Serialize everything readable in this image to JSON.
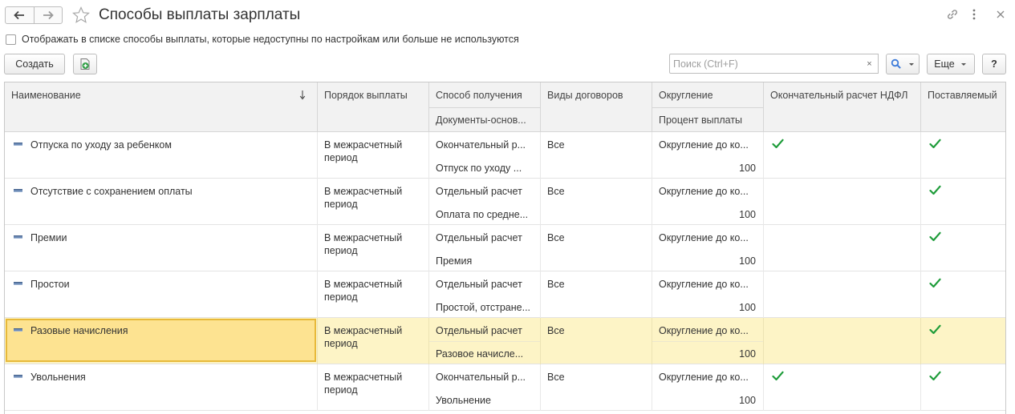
{
  "header": {
    "title": "Способы выплаты зарплаты"
  },
  "options": {
    "show_unavailable_label": "Отображать в списке способы выплаты, которые недоступны по настройкам или больше не используются"
  },
  "toolbar": {
    "create_label": "Создать",
    "search_placeholder": "Поиск (Ctrl+F)",
    "search_clear": "×",
    "more_label": "Еще",
    "help_label": "?"
  },
  "columns": {
    "name": "Наименование",
    "pay_order": "Порядок выплаты",
    "method": "Способ получения",
    "docs_basis": "Документы-основ...",
    "contracts": "Виды договоров",
    "rounding": "Округление",
    "pay_percent": "Процент выплаты",
    "final_ndfl": "Окончательный расчет НДФЛ",
    "supplied": "Поставляемый"
  },
  "rows": [
    {
      "name": "Отпуска по уходу за ребенком",
      "order_line1": "В межрасчетный",
      "order_line2": "период",
      "method": "Окончательный р...",
      "docs": "Отпуск по уходу ...",
      "contracts": "Все",
      "rounding": "Округление до ко...",
      "percent": "100",
      "final_ndfl": true,
      "supplied": true
    },
    {
      "name": "Отсутствие с сохранением оплаты",
      "order_line1": "В межрасчетный",
      "order_line2": "период",
      "method": "Отдельный расчет",
      "docs": "Оплата по средне...",
      "contracts": "Все",
      "rounding": "Округление до ко...",
      "percent": "100",
      "final_ndfl": false,
      "supplied": true
    },
    {
      "name": "Премии",
      "order_line1": "В межрасчетный",
      "order_line2": "период",
      "method": "Отдельный расчет",
      "docs": "Премия",
      "contracts": "Все",
      "rounding": "Округление до ко...",
      "percent": "100",
      "final_ndfl": false,
      "supplied": true
    },
    {
      "name": "Простои",
      "order_line1": "В межрасчетный",
      "order_line2": "период",
      "method": "Отдельный расчет",
      "docs": "Простой, отстране...",
      "contracts": "Все",
      "rounding": "Округление до ко...",
      "percent": "100",
      "final_ndfl": false,
      "supplied": true
    },
    {
      "name": "Разовые начисления",
      "order_line1": "В межрасчетный",
      "order_line2": "период",
      "method": "Отдельный расчет",
      "docs": "Разовое начисле...",
      "contracts": "Все",
      "rounding": "Округление до ко...",
      "percent": "100",
      "final_ndfl": false,
      "supplied": true,
      "selected": true
    },
    {
      "name": "Увольнения",
      "order_line1": "В межрасчетный",
      "order_line2": "период",
      "method": "Окончательный р...",
      "docs": "Увольнение",
      "contracts": "Все",
      "rounding": "Округление до ко...",
      "percent": "100",
      "final_ndfl": true,
      "supplied": true
    }
  ],
  "icons": {
    "back": "arrow-left-icon",
    "forward": "arrow-right-icon",
    "favorite": "star-icon",
    "link": "link-icon",
    "menu": "more-vertical-icon",
    "close": "close-icon",
    "add_copy": "add-document-icon",
    "search": "search-icon",
    "sort": "sort-down-icon",
    "row": "item-dash-icon",
    "check": "checkmark-icon"
  },
  "colors": {
    "selected_row": "#fdf4c6",
    "focused_cell": "#fde391",
    "check_green": "#1e9c3a",
    "search_blue": "#3d7bd9"
  }
}
